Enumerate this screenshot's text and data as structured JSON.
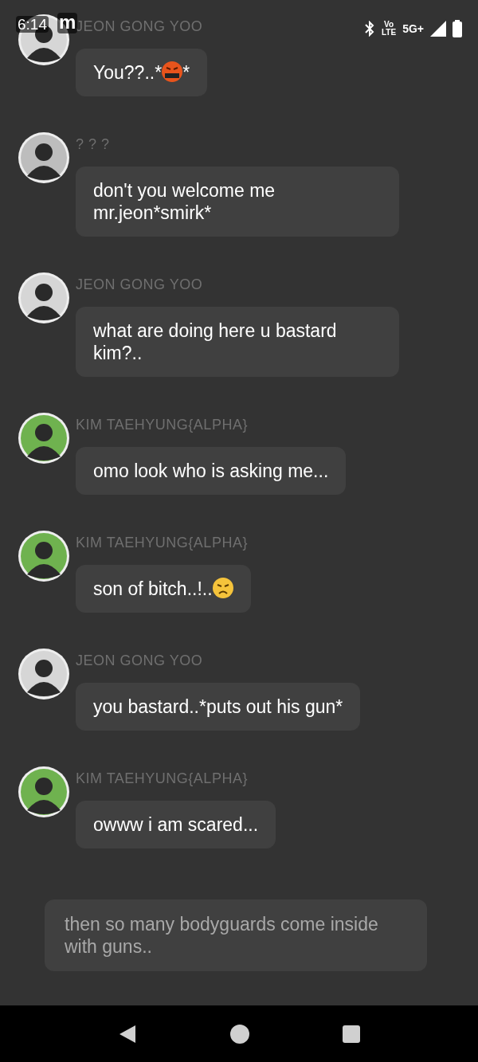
{
  "status_bar": {
    "time": "6:14",
    "notification": "m",
    "volte_top": "Vo",
    "volte_bottom": "LTE",
    "network": "5G+"
  },
  "messages": [
    {
      "sender": "JEON GONG YOO",
      "avatar": {
        "color": "#d6d6d6"
      },
      "parts": [
        {
          "kind": "text",
          "text": "You??..*"
        },
        {
          "kind": "cursing_emoji"
        },
        {
          "kind": "text",
          "text": "*"
        }
      ]
    },
    {
      "sender": "? ? ?",
      "avatar": {
        "color": "#bdbdbd"
      },
      "parts": [
        {
          "kind": "text",
          "text": "don't you welcome me mr.jeon*smirk*"
        }
      ]
    },
    {
      "sender": "JEON GONG YOO",
      "avatar": {
        "color": "#d6d6d6"
      },
      "parts": [
        {
          "kind": "text",
          "text": "what are doing here u bastard kim?.."
        }
      ]
    },
    {
      "sender": "KIM TAEHYUNG{ALPHA}",
      "avatar": {
        "color": "#6fb24f"
      },
      "parts": [
        {
          "kind": "text",
          "text": "omo look who is asking me..."
        }
      ]
    },
    {
      "sender": "KIM TAEHYUNG{ALPHA}",
      "avatar": {
        "color": "#6fb24f"
      },
      "parts": [
        {
          "kind": "text",
          "text": "son of bitch..!.."
        },
        {
          "kind": "angry_emoji"
        }
      ]
    },
    {
      "sender": "JEON GONG YOO",
      "avatar": {
        "color": "#d6d6d6"
      },
      "parts": [
        {
          "kind": "text",
          "text": "you bastard..*puts out his gun*"
        }
      ]
    },
    {
      "sender": "KIM TAEHYUNG{ALPHA}",
      "avatar": {
        "color": "#6fb24f"
      },
      "parts": [
        {
          "kind": "text",
          "text": "owww i am scared..."
        }
      ]
    }
  ],
  "narration": "then so many bodyguards come inside with guns.."
}
